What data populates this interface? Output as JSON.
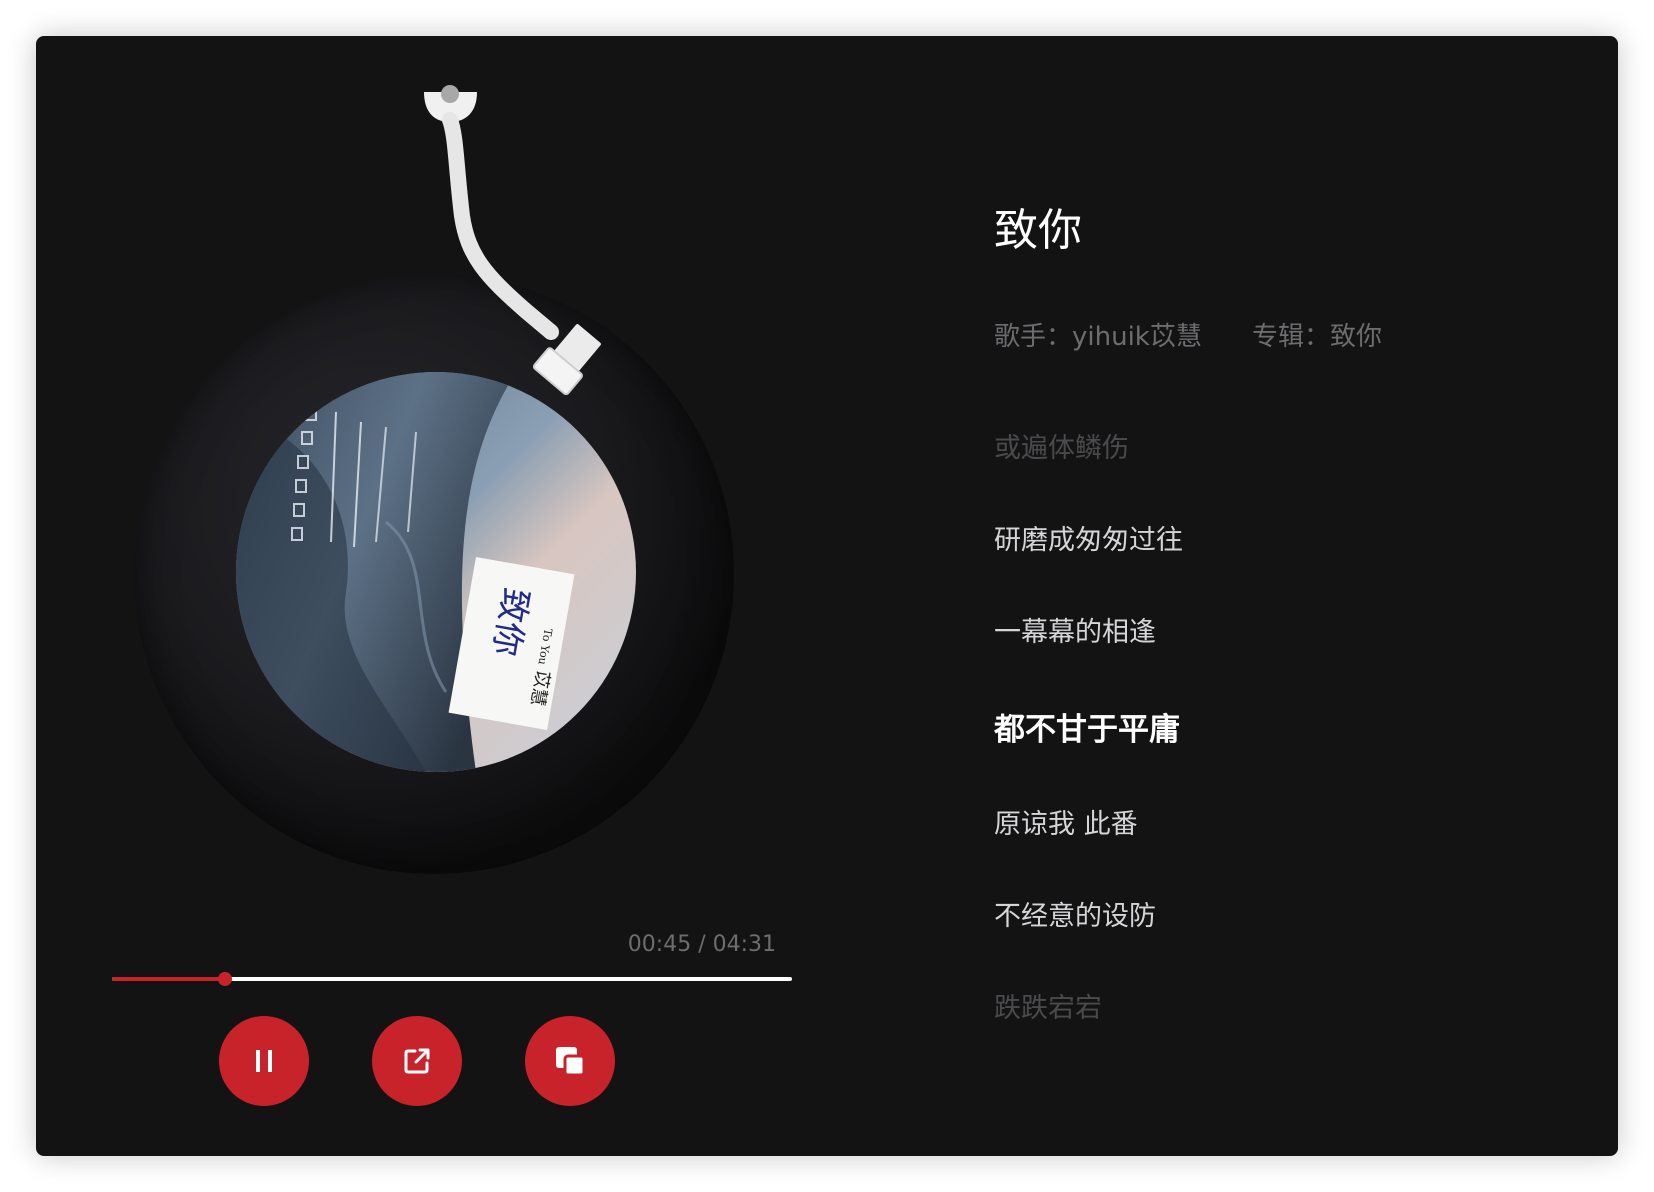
{
  "player": {
    "song_title": "致你",
    "artist_label": "歌手：",
    "artist": "yihuik苡慧",
    "album_label": "专辑：",
    "album": "致你",
    "current_time": "00:45",
    "total_time": "04:31",
    "time_display": "00:45 / 04:31",
    "progress": 0.166,
    "state": "playing"
  },
  "album_art": {
    "text": "致你",
    "subtitle": "To You",
    "signature": "苡慧"
  },
  "lyrics": [
    {
      "text": "或遍体鳞伤",
      "state": "faded"
    },
    {
      "text": "研磨成匆匆过往",
      "state": "normal"
    },
    {
      "text": "一幕幕的相逢",
      "state": "normal"
    },
    {
      "text": "都不甘于平庸",
      "state": "active"
    },
    {
      "text": "原谅我 此番",
      "state": "normal"
    },
    {
      "text": "不经意的设防",
      "state": "normal"
    },
    {
      "text": "跌跌宕宕",
      "state": "faded"
    }
  ],
  "controls": [
    {
      "name": "pause-button",
      "icon": "pause-icon"
    },
    {
      "name": "share-button",
      "icon": "external-link-icon"
    },
    {
      "name": "copy-button",
      "icon": "copy-icon"
    }
  ],
  "colors": {
    "background": "#131314",
    "accent": "#c8232a",
    "text_primary": "#ffffff",
    "text_secondary": "#6d6d70"
  }
}
